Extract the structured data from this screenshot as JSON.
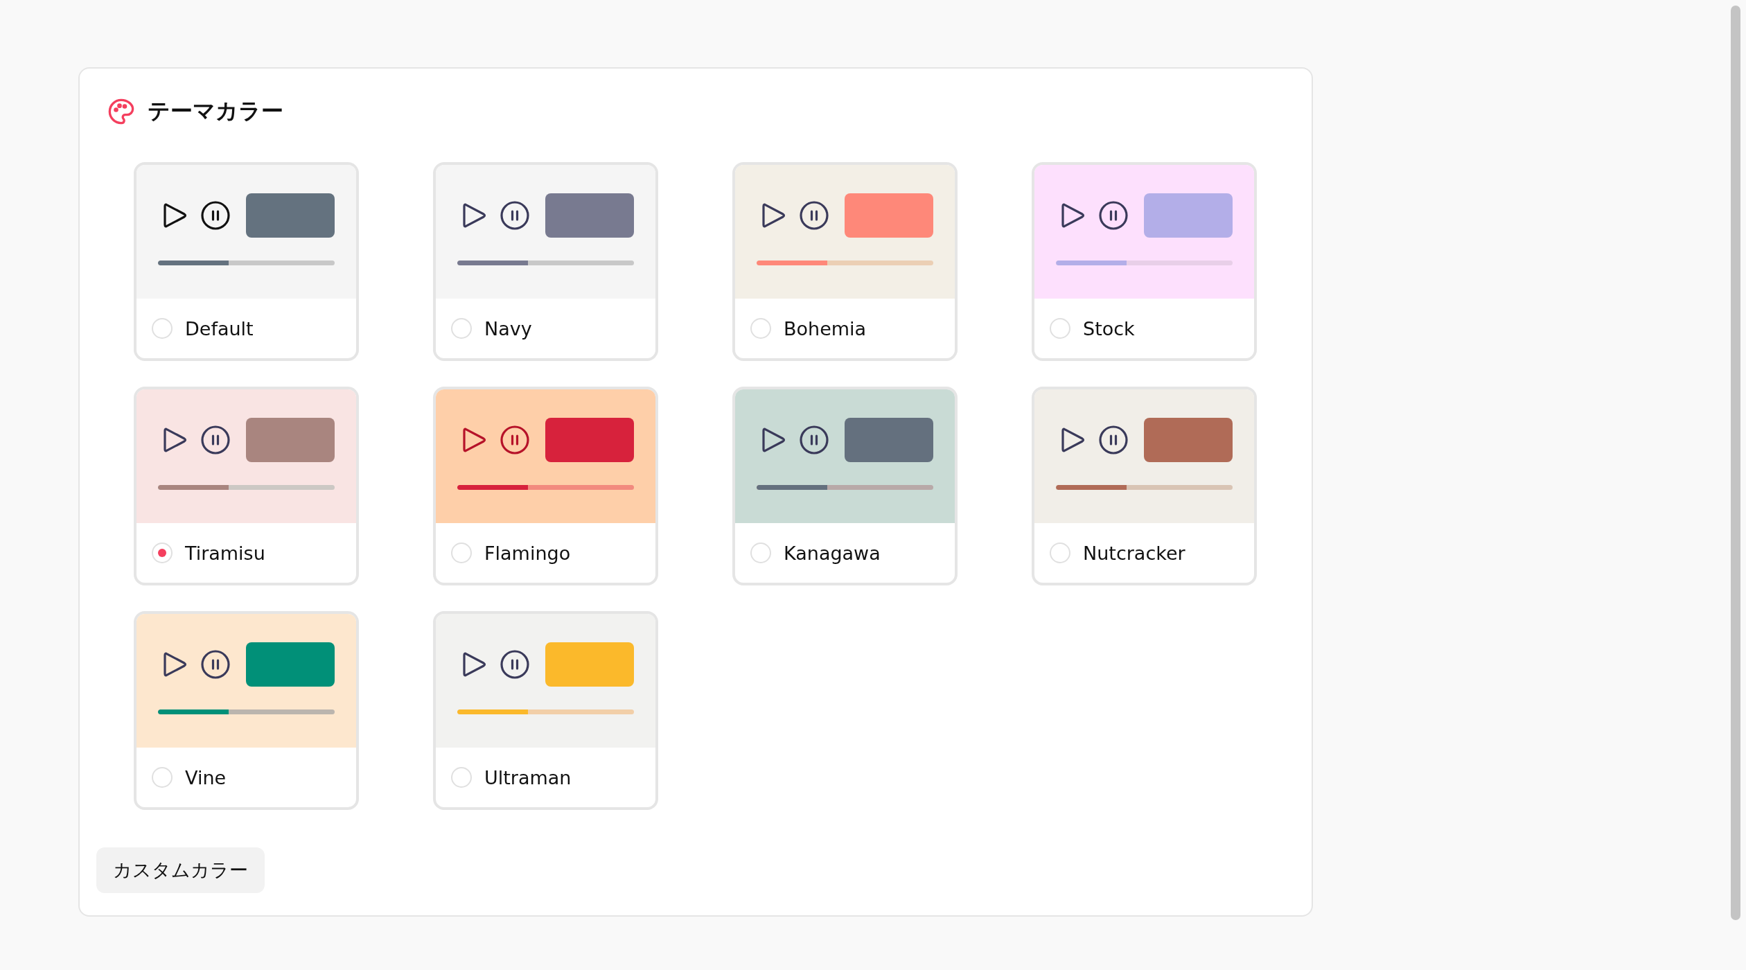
{
  "panel": {
    "title": "テーマカラー"
  },
  "themes": [
    {
      "name": "Default",
      "selected": false,
      "preview": {
        "color": "#f5f5f5"
      },
      "icons": {
        "color": "#111111"
      },
      "color": "#64727f",
      "track": {
        "color": "#c8c8c8"
      },
      "level": 0.4
    },
    {
      "name": "Navy",
      "selected": false,
      "preview": {
        "color": "#f5f5f5"
      },
      "icons": {
        "color": "#3a3a5a"
      },
      "color": "#787a90",
      "track": {
        "color": "#c8c8c8"
      },
      "level": 0.4
    },
    {
      "name": "Bohemia",
      "selected": false,
      "preview": {
        "color": "#f3efe6"
      },
      "icons": {
        "color": "#3a3a5a"
      },
      "color": "#fe8879",
      "track": {
        "color": "#ebcfb4"
      },
      "level": 0.4
    },
    {
      "name": "Stock",
      "selected": false,
      "preview": {
        "color": "#fde0fd"
      },
      "icons": {
        "color": "#3a3a5a"
      },
      "color": "#b3aee8",
      "track": {
        "color": "#e8cfe8"
      },
      "level": 0.4
    },
    {
      "name": "Tiramisu",
      "selected": true,
      "preview": {
        "color": "#f9e4e3"
      },
      "icons": {
        "color": "#3a3a5a"
      },
      "color": "#a9857f",
      "track": {
        "color": "#ccc8c4"
      },
      "level": 0.4
    },
    {
      "name": "Flamingo",
      "selected": false,
      "preview": {
        "color": "#fecfa9"
      },
      "icons": {
        "color": "#b61329"
      },
      "color": "#d7223c",
      "track": {
        "color": "#f28a7e"
      },
      "level": 0.4
    },
    {
      "name": "Kanagawa",
      "selected": false,
      "preview": {
        "color": "#c9dbd5"
      },
      "icons": {
        "color": "#3a3a5a"
      },
      "color": "#64707e",
      "track": {
        "color": "#b8a9a8"
      },
      "level": 0.4
    },
    {
      "name": "Nutcracker",
      "selected": false,
      "preview": {
        "color": "#f1eee8"
      },
      "icons": {
        "color": "#3a3a5a"
      },
      "color": "#b06b57",
      "track": {
        "color": "#d9c4b4"
      },
      "level": 0.4
    },
    {
      "name": "Vine",
      "selected": false,
      "preview": {
        "color": "#fde7ce"
      },
      "icons": {
        "color": "#3a3a5a"
      },
      "color": "#019078",
      "track": {
        "color": "#bbb5ae"
      },
      "level": 0.4
    },
    {
      "name": "Ultraman",
      "selected": false,
      "preview": {
        "color": "#f2f2f0"
      },
      "icons": {
        "color": "#3a3a5a"
      },
      "color": "#fbb92b",
      "track": {
        "color": "#f2cfa8"
      },
      "level": 0.4
    }
  ],
  "custom_button": {
    "label": "カスタムカラー"
  }
}
